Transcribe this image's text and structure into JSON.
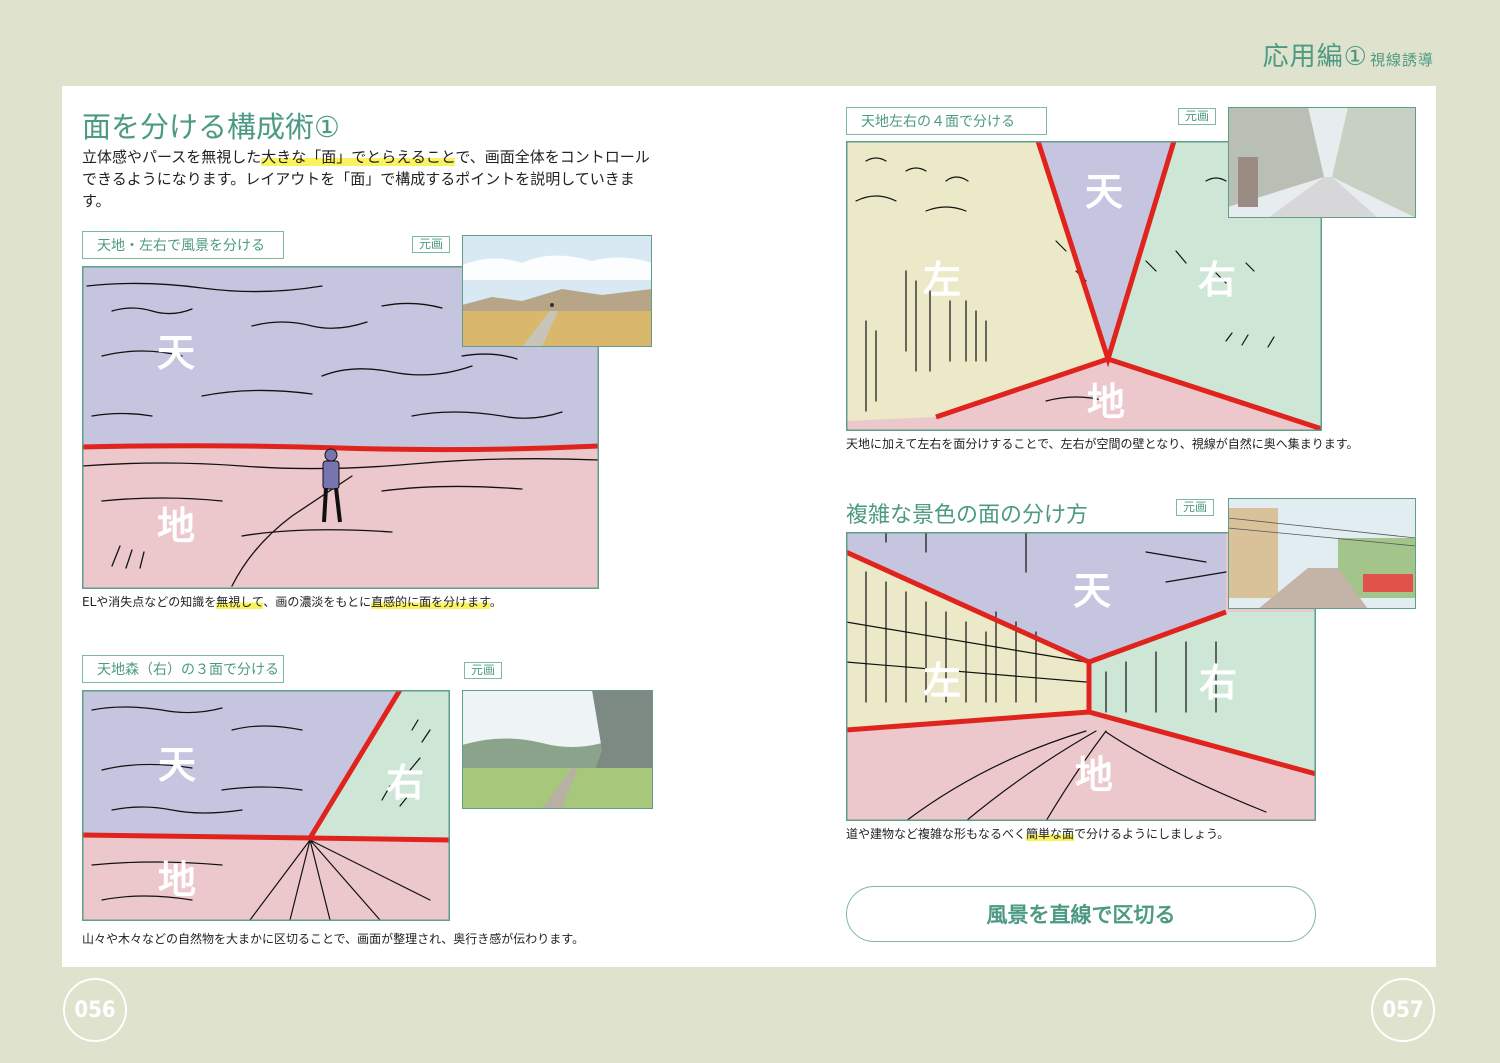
{
  "chapter": {
    "title": "応用編",
    "num": "①",
    "sub": "視線誘導"
  },
  "pages": {
    "left": "056",
    "right": "057"
  },
  "title": "面を分ける構成術①",
  "intro": {
    "p1": "立体感やパースを無視した",
    "p2": "大きな「面」でとらえること",
    "p3": "で、画面全体をコントロールできるようになります。レイアウトを「面」で構成するポイントを説明していきます。"
  },
  "orig_label": "元画",
  "panels": [
    {
      "label": "天地・左右で風景を分ける",
      "cap": [
        "ELや消失点などの知識を",
        "無視して",
        "、画の濃淡をもとに",
        "直感的に面を分けます",
        "。"
      ]
    },
    {
      "label": "天地森（右）の３面で分ける",
      "cap": [
        "山々や木々などの自然物を大まかに区切ることで、画面が整理され、奥行き感が伝わります。"
      ]
    },
    {
      "label": "天地左右の４面で分ける",
      "cap": [
        "天地に加えて左右を面分けすることで、左右が空間の壁となり、視線が自然に奥へ集まります。"
      ]
    },
    {
      "heading": "複雑な景色の面の分け方",
      "cap": [
        "道や建物など複雑な形もなるべく",
        "簡単な面",
        "で分けるようにしましょう。"
      ]
    }
  ],
  "faces": {
    "sky": "天",
    "ground": "地",
    "left": "左",
    "right": "右"
  },
  "button": "風景を直線で区切る",
  "colors": {
    "accent": "#4d9a84",
    "sky": "#c5c5df",
    "ground": "#ecc8cc",
    "left": "#ebe9c8",
    "right": "#cde6d6",
    "line": "#e0231d"
  }
}
